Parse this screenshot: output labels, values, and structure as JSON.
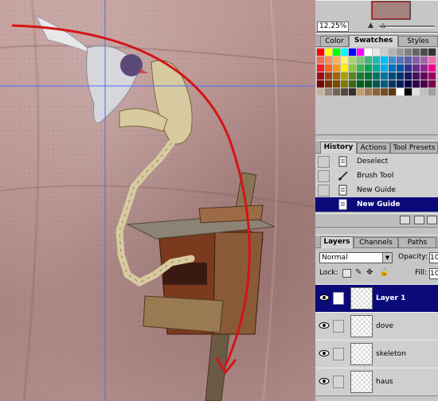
{
  "navigator": {
    "zoom_value": "12,25%"
  },
  "swatches_palette": {
    "tabs": [
      {
        "label": "Color",
        "active": false
      },
      {
        "label": "Swatches",
        "active": true
      },
      {
        "label": "Styles",
        "active": false
      }
    ],
    "colors": [
      "#ff0000",
      "#ffff00",
      "#00ff00",
      "#00ffff",
      "#0000ff",
      "#ff00ff",
      "#ffffff",
      "#e6e6e6",
      "#cccccc",
      "#b3b3b3",
      "#999999",
      "#808080",
      "#666666",
      "#4d4d4d",
      "#333333",
      "#f26c4f",
      "#f68e55",
      "#fbaf5d",
      "#fff467",
      "#acd372",
      "#7cc576",
      "#3bb878",
      "#1abbb4",
      "#00bff3",
      "#438ccb",
      "#5574b9",
      "#605ca8",
      "#855fa8",
      "#a763a8",
      "#f06ea9",
      "#ed1c24",
      "#f26522",
      "#f7941d",
      "#fff200",
      "#8dc73f",
      "#39b54a",
      "#00a651",
      "#00a99d",
      "#00aeef",
      "#0072bc",
      "#0054a6",
      "#2e3192",
      "#662d91",
      "#92278f",
      "#ec008c",
      "#9e0b0f",
      "#a0410d",
      "#a3620a",
      "#aba000",
      "#598527",
      "#1a7b30",
      "#007236",
      "#00746b",
      "#0076a3",
      "#004b80",
      "#003471",
      "#1b1464",
      "#440e62",
      "#630460",
      "#9e005d",
      "#790000",
      "#7b2e00",
      "#7d4900",
      "#827b00",
      "#406618",
      "#005e20",
      "#005826",
      "#005952",
      "#005b7f",
      "#003663",
      "#002157",
      "#0d004c",
      "#32004b",
      "#4b0049",
      "#7b0046",
      "#c7b299",
      "#998675",
      "#736357",
      "#534741",
      "#37302d",
      "#c69c6d",
      "#a67c52",
      "#8c6239",
      "#754c24",
      "#603913",
      "#ffffff",
      "#000000",
      "#e0e0e0",
      "#c0c0c0",
      "#a0a0a0"
    ]
  },
  "history_palette": {
    "tabs": [
      {
        "label": "History",
        "active": true
      },
      {
        "label": "Actions",
        "active": false
      },
      {
        "label": "Tool Presets",
        "active": false
      }
    ],
    "items": [
      {
        "label": "Deselect",
        "icon": "document-icon",
        "selected": false
      },
      {
        "label": "Brush Tool",
        "icon": "brush-icon",
        "selected": false
      },
      {
        "label": "New Guide",
        "icon": "document-icon",
        "selected": false
      },
      {
        "label": "New Guide",
        "icon": "document-icon",
        "selected": true
      }
    ]
  },
  "layers_palette": {
    "tabs": [
      {
        "label": "Layers",
        "active": true
      },
      {
        "label": "Channels",
        "active": false
      },
      {
        "label": "Paths",
        "active": false
      }
    ],
    "blend_mode": "Normal",
    "opacity_label": "Opacity:",
    "opacity_value": "10",
    "lock_label": "Lock:",
    "fill_label": "Fill:",
    "fill_value": "10",
    "layers": [
      {
        "name": "Layer 1",
        "visible": true,
        "selected": true
      },
      {
        "name": "dove",
        "visible": true,
        "selected": false
      },
      {
        "name": "skeleton",
        "visible": true,
        "selected": false
      },
      {
        "name": "haus",
        "visible": true,
        "selected": false
      }
    ]
  },
  "colors": {
    "selection_blue": "#0a0a7a",
    "guide_blue": "#4a6cff",
    "arrow_red": "#d41414",
    "panel_gray": "#c6c6c6"
  }
}
